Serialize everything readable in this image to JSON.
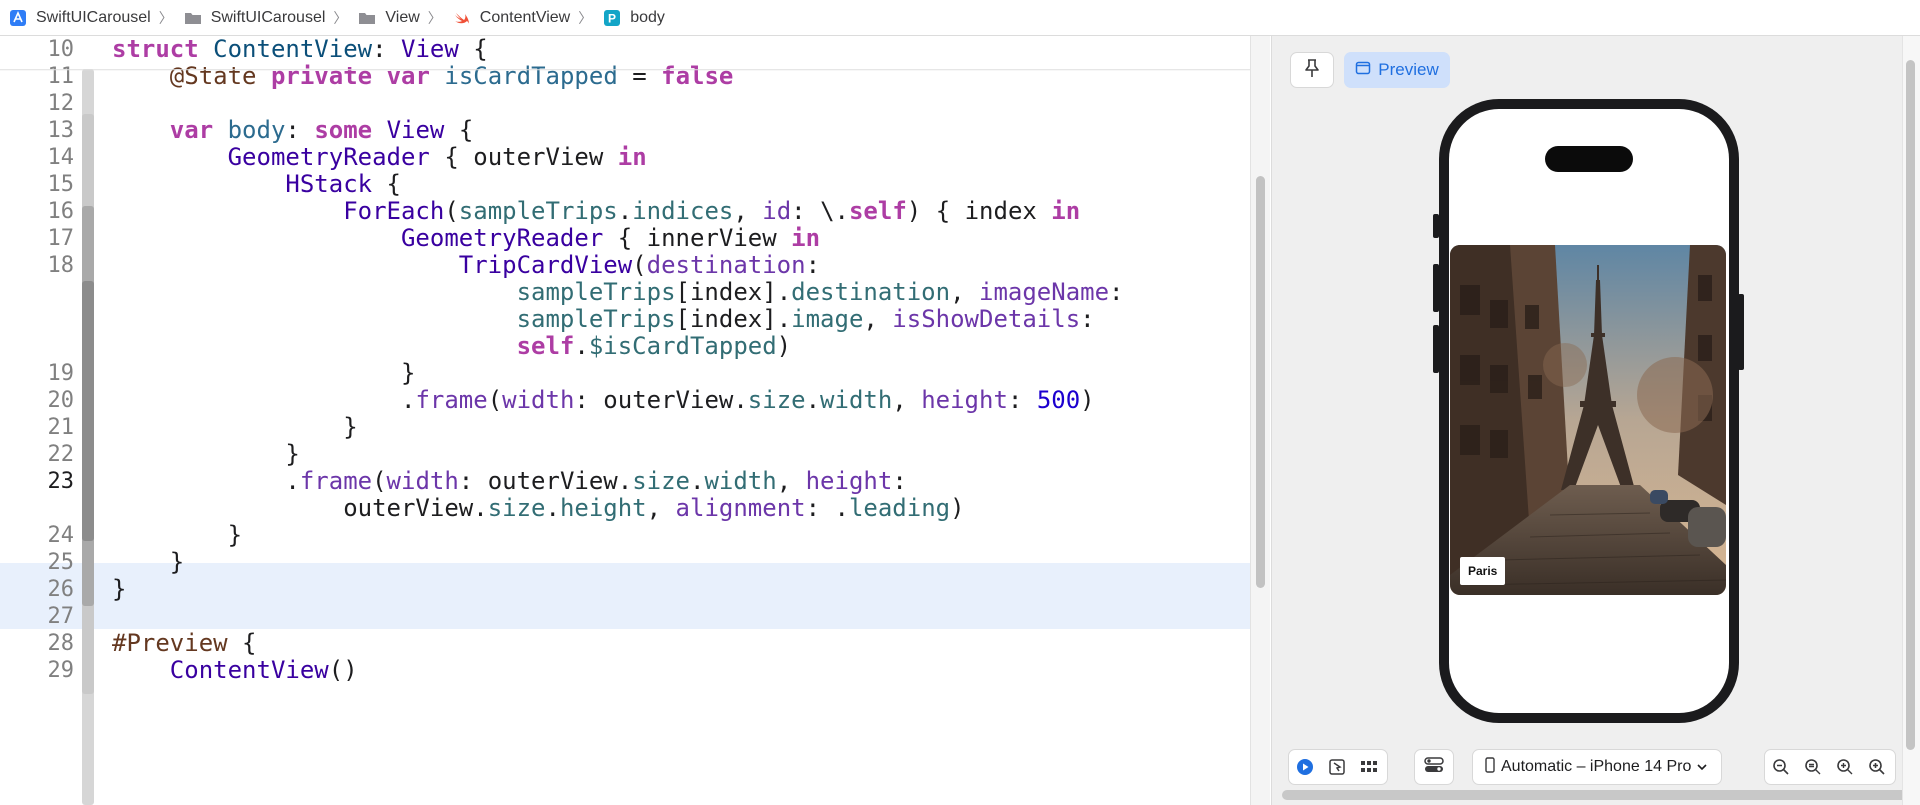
{
  "breadcrumb": [
    {
      "label": "SwiftUICarousel",
      "icon": "project-icon"
    },
    {
      "label": "SwiftUICarousel",
      "icon": "folder-icon"
    },
    {
      "label": "View",
      "icon": "folder-icon"
    },
    {
      "label": "ContentView",
      "icon": "swift-file-icon"
    },
    {
      "label": "body",
      "icon": "property-icon"
    }
  ],
  "editor": {
    "current_line": "23",
    "lines": [
      {
        "n": "10",
        "code": "struct ContentView: View {"
      },
      {
        "n": "11",
        "code": "    @State private var isCardTapped = false"
      },
      {
        "n": "12",
        "code": ""
      },
      {
        "n": "13",
        "code": "    var body: some View {"
      },
      {
        "n": "14",
        "code": "        GeometryReader { outerView in"
      },
      {
        "n": "15",
        "code": "            HStack {"
      },
      {
        "n": "16",
        "code": "                ForEach(sampleTrips.indices, id: \\.self) { index in"
      },
      {
        "n": "17",
        "code": "                    GeometryReader { innerView in"
      },
      {
        "n": "18",
        "code": "                        TripCardView(destination:"
      },
      {
        "n": "",
        "code": "                            sampleTrips[index].destination, imageName:"
      },
      {
        "n": "",
        "code": "                            sampleTrips[index].image, isShowDetails:"
      },
      {
        "n": "",
        "code": "                            self.$isCardTapped)"
      },
      {
        "n": "19",
        "code": "                    }"
      },
      {
        "n": "20",
        "code": "                    .frame(width: outerView.size.width, height: 500)"
      },
      {
        "n": "21",
        "code": "                }"
      },
      {
        "n": "22",
        "code": "            }"
      },
      {
        "n": "23",
        "code": "            .frame(width: outerView.size.width, height:"
      },
      {
        "n": "",
        "code": "                outerView.size.height, alignment: .leading)"
      },
      {
        "n": "24",
        "code": "        }"
      },
      {
        "n": "25",
        "code": "    }"
      },
      {
        "n": "26",
        "code": "}"
      },
      {
        "n": "27",
        "code": ""
      },
      {
        "n": "28",
        "code": "#Preview {"
      },
      {
        "n": "29",
        "code": "    ContentView()"
      }
    ]
  },
  "canvas": {
    "pin_icon": "pin-icon",
    "preview_label": "Preview",
    "card_label": "Paris",
    "device_label": "Automatic – iPhone 14 Pro",
    "toolbar_icons": [
      "live-play-icon",
      "selectable-icon",
      "variants-grid-icon",
      "device-settings-icon",
      "zoom-out-icon",
      "zoom-fit-icon",
      "zoom-100-icon",
      "zoom-in-icon"
    ],
    "accent": "#1f6fe0"
  },
  "colors": {
    "keyword": "#ad3da4",
    "type": "#3900a0",
    "project": "#326d74",
    "number": "#1c00cf",
    "highlight": "#e8f0fc"
  }
}
